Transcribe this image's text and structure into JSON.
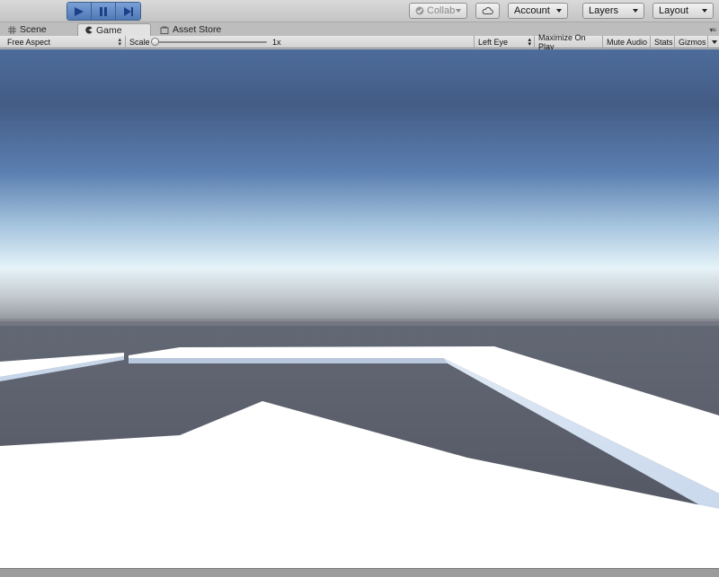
{
  "toolbar": {
    "play_controls": [
      "play-icon",
      "pause-icon",
      "step-icon"
    ],
    "collab_label": "Collab",
    "cloud_icon": "cloud-icon",
    "account_label": "Account",
    "layers_label": "Layers",
    "layout_label": "Layout"
  },
  "tabs": [
    {
      "label": "Scene",
      "icon": "grid-icon",
      "active": false
    },
    {
      "label": "Game",
      "icon": "pacman-icon",
      "active": true
    },
    {
      "label": "Asset Store",
      "icon": "store-icon",
      "active": false
    }
  ],
  "game_toolbar": {
    "aspect": "Free Aspect",
    "scale_label": "Scale",
    "scale_value": "1x",
    "eye": "Left Eye",
    "maximize": "Maximize On Play",
    "mute": "Mute Audio",
    "stats": "Stats",
    "gizmos": "Gizmos"
  },
  "colors": {
    "sky_top": "#4a6896",
    "sky_horizon": "#eef6fa",
    "ground": "#5b6170",
    "platform": "#ffffff",
    "play_active": "#4f78b5"
  }
}
